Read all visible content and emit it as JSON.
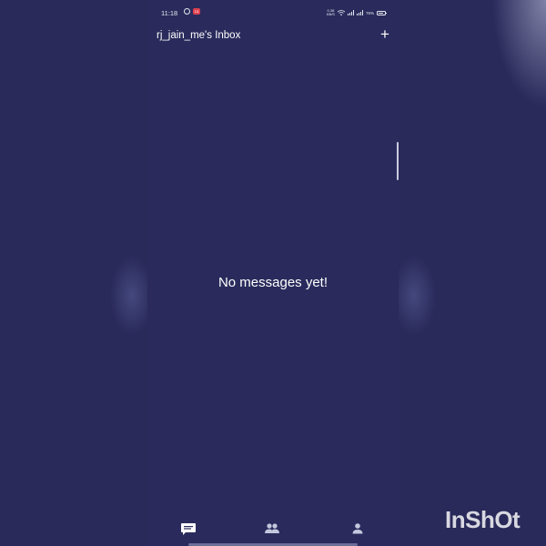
{
  "status_bar": {
    "time": "11:18",
    "notification_count": "13",
    "net_speed_value": "0.38",
    "net_speed_unit": "KB/S",
    "battery": "76%",
    "battery_level": 0.76
  },
  "header": {
    "title": "rj_jain_me's Inbox",
    "add_label": "+"
  },
  "main": {
    "empty_message": "No messages yet!"
  },
  "bottom_nav": {
    "items": [
      {
        "icon": "chat-icon",
        "active": true
      },
      {
        "icon": "people-icon",
        "active": false
      },
      {
        "icon": "person-icon",
        "active": false
      }
    ]
  },
  "watermark": {
    "text": "InShOt"
  },
  "colors": {
    "background": "#29295a",
    "text": "#ffffff"
  }
}
